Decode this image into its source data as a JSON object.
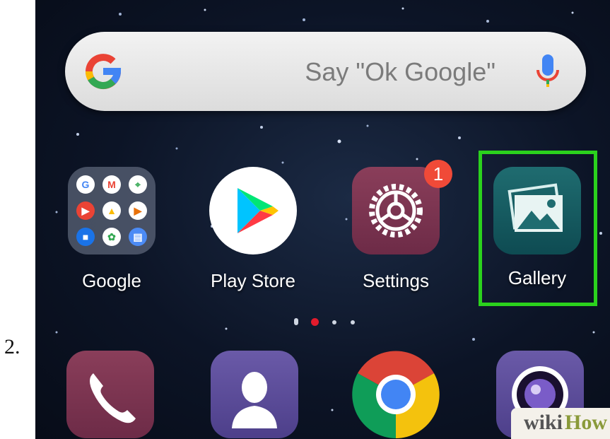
{
  "step": {
    "number": "2."
  },
  "search": {
    "hint": "Say \"Ok Google\"",
    "icons": [
      "google-g-icon",
      "microphone-icon"
    ]
  },
  "apps": [
    {
      "label": "Google",
      "icon": "google-folder-icon"
    },
    {
      "label": "Play Store",
      "icon": "play-store-icon"
    },
    {
      "label": "Settings",
      "icon": "gear-icon",
      "badge": "1"
    },
    {
      "label": "Gallery",
      "icon": "gallery-icon",
      "highlighted": true
    }
  ],
  "page_indicator": {
    "count": 4,
    "active_index": 1
  },
  "dock": [
    {
      "icon": "phone-icon"
    },
    {
      "icon": "contacts-icon"
    },
    {
      "icon": "chrome-icon"
    },
    {
      "icon": "camera-icon"
    }
  ],
  "watermark": {
    "part1": "wiki",
    "part2": "How"
  },
  "colors": {
    "highlight": "#2bd21d",
    "badge": "#f04a38",
    "active_dot": "#e21b2c"
  }
}
